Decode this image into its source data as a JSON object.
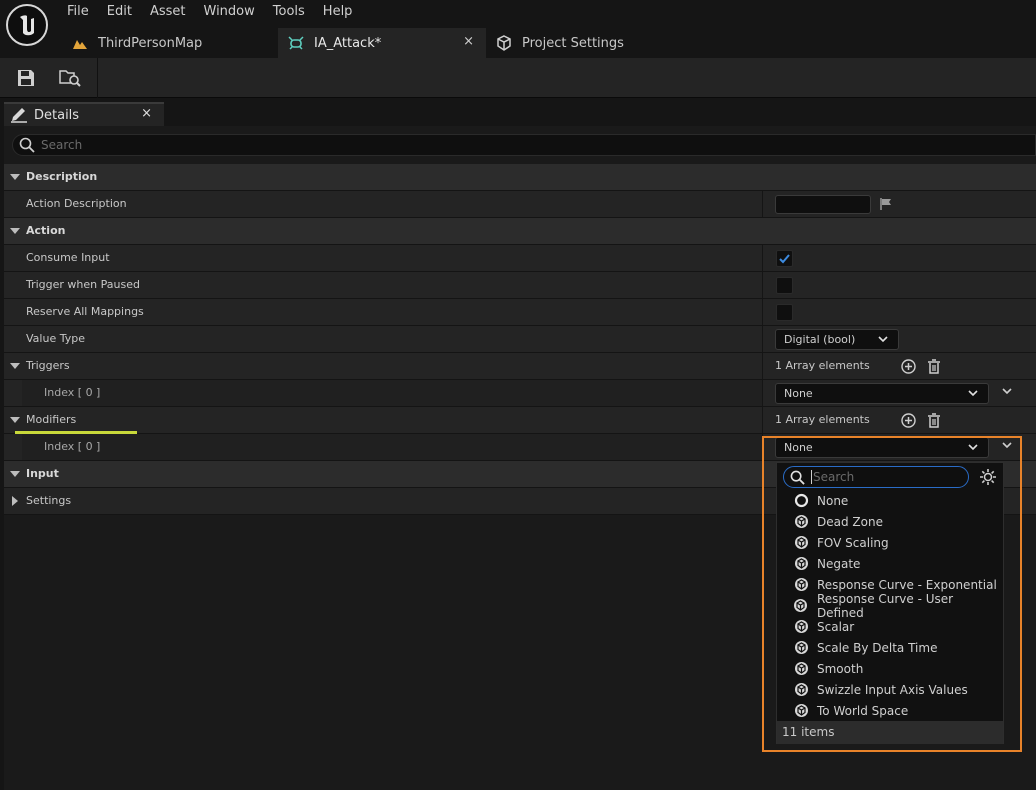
{
  "menu": [
    "File",
    "Edit",
    "Asset",
    "Window",
    "Tools",
    "Help"
  ],
  "tabs": [
    {
      "label": "ThirdPersonMap"
    },
    {
      "label": "IA_Attack*",
      "close": "×"
    },
    {
      "label": "Project Settings"
    }
  ],
  "details": {
    "tab_label": "Details",
    "close": "×",
    "search_placeholder": "Search"
  },
  "sections": {
    "description": {
      "title": "Description",
      "action_description_label": "Action Description"
    },
    "action": {
      "title": "Action",
      "consume_input": "Consume Input",
      "trigger_when_paused": "Trigger when Paused",
      "reserve_all_mappings": "Reserve All Mappings",
      "value_type_label": "Value Type",
      "value_type_value": "Digital (bool)",
      "triggers_label": "Triggers",
      "triggers_count": "1 Array elements",
      "triggers_index": "Index [ 0 ]",
      "triggers_value": "None",
      "modifiers_label": "Modifiers",
      "modifiers_count": "1 Array elements",
      "modifiers_index": "Index [ 0 ]",
      "modifiers_value": "None"
    },
    "input": {
      "title": "Input"
    },
    "settings": {
      "title": "Settings"
    }
  },
  "checkbox_states": {
    "consume_input": true,
    "trigger_when_paused": false,
    "reserve_all_mappings": false
  },
  "dropdown": {
    "search_placeholder": "Search",
    "items": [
      "None",
      "Dead Zone",
      "FOV Scaling",
      "Negate",
      "Response Curve - Exponential",
      "Response Curve - User Defined",
      "Scalar",
      "Scale By Delta Time",
      "Smooth",
      "Swizzle Input Axis Values",
      "To World Space"
    ],
    "footer": "11 items"
  },
  "colors": {
    "highlight_outline": "#e8832a",
    "accent_blue": "#2a6cc7",
    "check_blue": "#3d8be0",
    "modifier_underline": "#c8d83a"
  }
}
